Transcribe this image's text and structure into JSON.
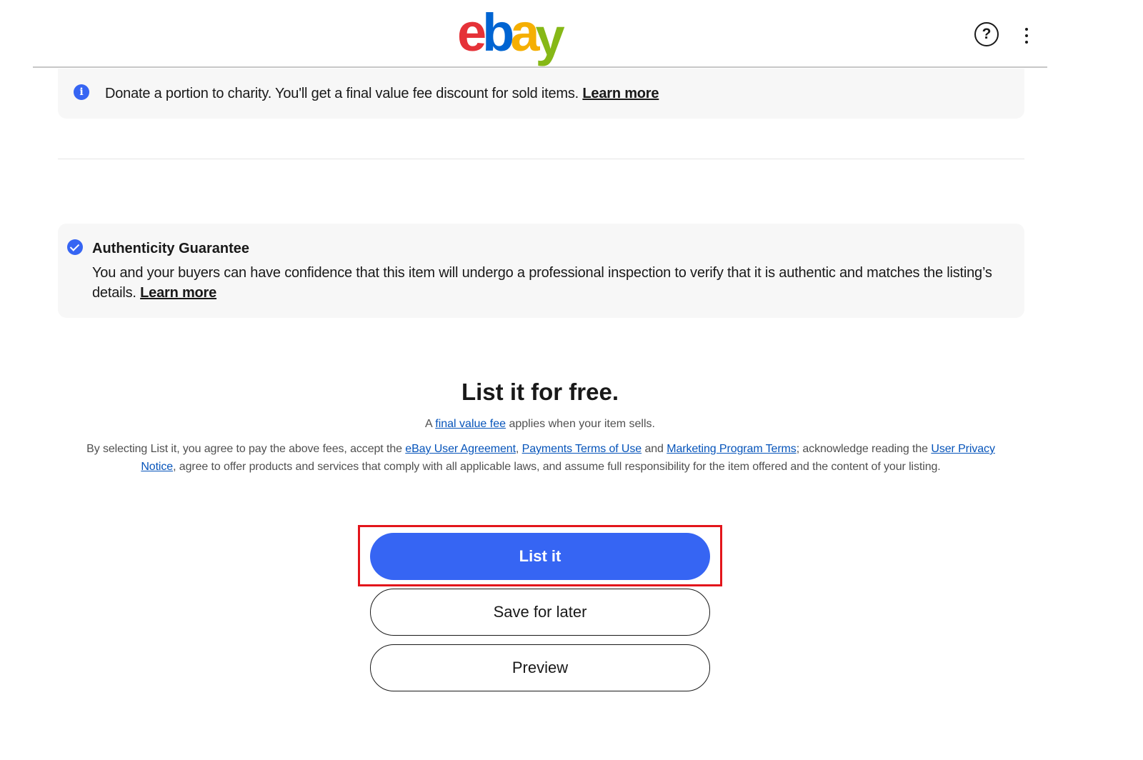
{
  "header": {
    "logo": {
      "e": "e",
      "b": "b",
      "a": "a",
      "y": "y"
    },
    "help_symbol": "?",
    "icons": {
      "help": "help-circle-icon",
      "more": "more-vertical-icon"
    }
  },
  "charity_banner": {
    "icon": "info-icon",
    "text": "Donate a portion to charity. You'll get a final value fee discount for sold items.",
    "link": "Learn more"
  },
  "authenticity": {
    "icon": "check-circle-icon",
    "title": "Authenticity Guarantee",
    "body": "You and your buyers can have confidence that this item will undergo a professional inspection to verify that it is authentic and matches the listing’s details.",
    "link": "Learn more"
  },
  "listing": {
    "title": "List it for free.",
    "fee_prefix": "A",
    "fee_link": "final value fee",
    "fee_suffix": "applies when your item sells.",
    "legal": {
      "p1": "By selecting List it, you agree to pay the above fees, accept the",
      "link1": "eBay User Agreement",
      "sep1": ",",
      "link2": "Payments Terms of Use",
      "p2": "and",
      "link3": "Marketing Program Terms",
      "p3": "; acknowledge reading the",
      "link4": "User Privacy Notice",
      "p4": ", agree to offer products and services that comply with all applicable laws, and assume full responsibility for the item offered and the content of your listing."
    }
  },
  "buttons": {
    "list_it": "List it",
    "save_for_later": "Save for later",
    "preview": "Preview"
  },
  "colors": {
    "primary": "#3665f3",
    "highlight": "#e3151b",
    "link": "#0654ba"
  }
}
